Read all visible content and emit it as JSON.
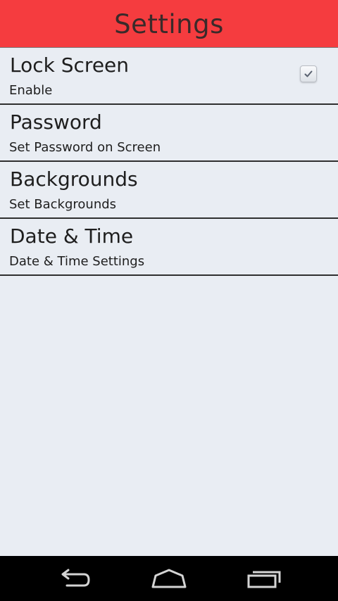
{
  "header": {
    "title": "Settings",
    "background_color": "#f53c3f"
  },
  "settings": {
    "items": [
      {
        "title": "Lock Screen",
        "subtitle": "Enable",
        "checked": true
      },
      {
        "title": "Password",
        "subtitle": "Set Password on Screen"
      },
      {
        "title": "Backgrounds",
        "subtitle": "Set Backgrounds"
      },
      {
        "title": "Date & Time",
        "subtitle": "Date & Time Settings"
      }
    ]
  },
  "navbar": {
    "back_icon": "back-icon",
    "home_icon": "home-icon",
    "recents_icon": "recent-apps-icon"
  }
}
